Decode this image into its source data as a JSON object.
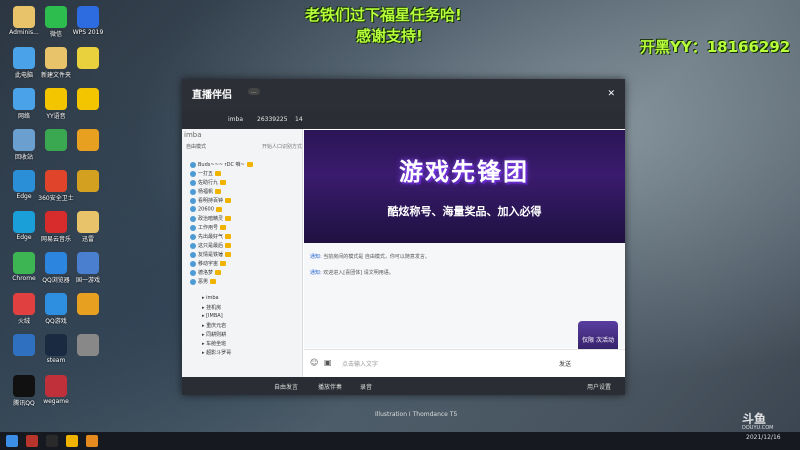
{
  "overlay": {
    "line1": "老铁们过下福星任务哈!",
    "line2": "感谢支持!",
    "line3": "开黑YY：18166292"
  },
  "desktop_icons": [
    {
      "label": "Adminis...",
      "color": "#e8c36a"
    },
    {
      "label": "微信",
      "color": "#2dbd4e"
    },
    {
      "label": "WPS 2019",
      "color": "#2c6be0"
    },
    {
      "label": "此电脑",
      "color": "#4aa3e8"
    },
    {
      "label": "新建文件夹",
      "color": "#e8c36a"
    },
    {
      "label": "",
      "color": "#e8d13c"
    },
    {
      "label": "网络",
      "color": "#4aa3e8"
    },
    {
      "label": "YY语音",
      "color": "#f2c500"
    },
    {
      "label": "",
      "color": "#f2c500"
    },
    {
      "label": "回收站",
      "color": "#6a9fd0"
    },
    {
      "label": "",
      "color": "#3aa850"
    },
    {
      "label": "",
      "color": "#e8a020"
    },
    {
      "label": "Edge",
      "color": "#2a8fd6"
    },
    {
      "label": "360安全卫士",
      "color": "#e0452b"
    },
    {
      "label": "",
      "color": "#d4a020"
    },
    {
      "label": "Edge",
      "color": "#1a9fd8"
    },
    {
      "label": "网易云音乐",
      "color": "#d82c2c"
    },
    {
      "label": "迅雷",
      "color": "#e8c36a"
    },
    {
      "label": "Chrome",
      "color": "#3db553"
    },
    {
      "label": "QQ浏览器",
      "color": "#2c86e0"
    },
    {
      "label": "国一游戏",
      "color": "#4a7fd0"
    },
    {
      "label": "火绒",
      "color": "#e04040"
    },
    {
      "label": "QQ游戏",
      "color": "#2e8fe0"
    },
    {
      "label": "",
      "color": "#e8a020"
    },
    {
      "label": "",
      "color": "#3070c0"
    },
    {
      "label": "steam",
      "color": "#1a2a40"
    },
    {
      "label": "",
      "color": "#888"
    },
    {
      "label": "腾讯QQ",
      "color": "#111"
    },
    {
      "label": "wegame",
      "color": "#c0303a"
    }
  ],
  "window": {
    "logo": "直播伴侣",
    "room": {
      "name": "imba",
      "id": "26339225",
      "count": "14"
    },
    "sidebar": {
      "head": "imba",
      "mode": "自由模式",
      "link": "开始人口识别方式",
      "users": [
        "Buds~~~ rDC 咱~",
        "一打五",
        "佐助行九",
        "杨福帆",
        "看明持百钟",
        "20600",
        "政治暗精灵",
        "工作用号",
        "先出最好气",
        "这只是最后",
        "友情是铁锤",
        "移动宇宙",
        "德洛梦",
        "恶男"
      ],
      "channels": [
        "imba",
        "挂机房",
        "[IMBA]",
        "重庆元岩",
        "同耕则耕",
        "车舱坐班",
        "超影斗罗哥"
      ]
    },
    "banner": {
      "title": "游戏先锋团",
      "subtitle": "酷炫称号、海量奖品、加入必得"
    },
    "messages": [
      {
        "tag": "通知:",
        "text": "当前房间的模式是 自由模式，你可以随意发言。"
      },
      {
        "tag": "通知:",
        "text": "欢迎进入[喜团体] 请文明用语。"
      }
    ],
    "promo": "仅限 次活动",
    "input_placeholder": "点击输入文字",
    "send_label": "发送",
    "bottom": {
      "speak": "自由发言",
      "music": "播放伴奏",
      "record": "录音",
      "user_settings": "用户设置"
    }
  },
  "taskbar": {
    "time": "2021/12/16",
    "date": ""
  },
  "illustration_credit": "Illustration I Thomdance T5",
  "watermark": {
    "main": "斗鱼",
    "sub": "DOUYU.COM"
  }
}
